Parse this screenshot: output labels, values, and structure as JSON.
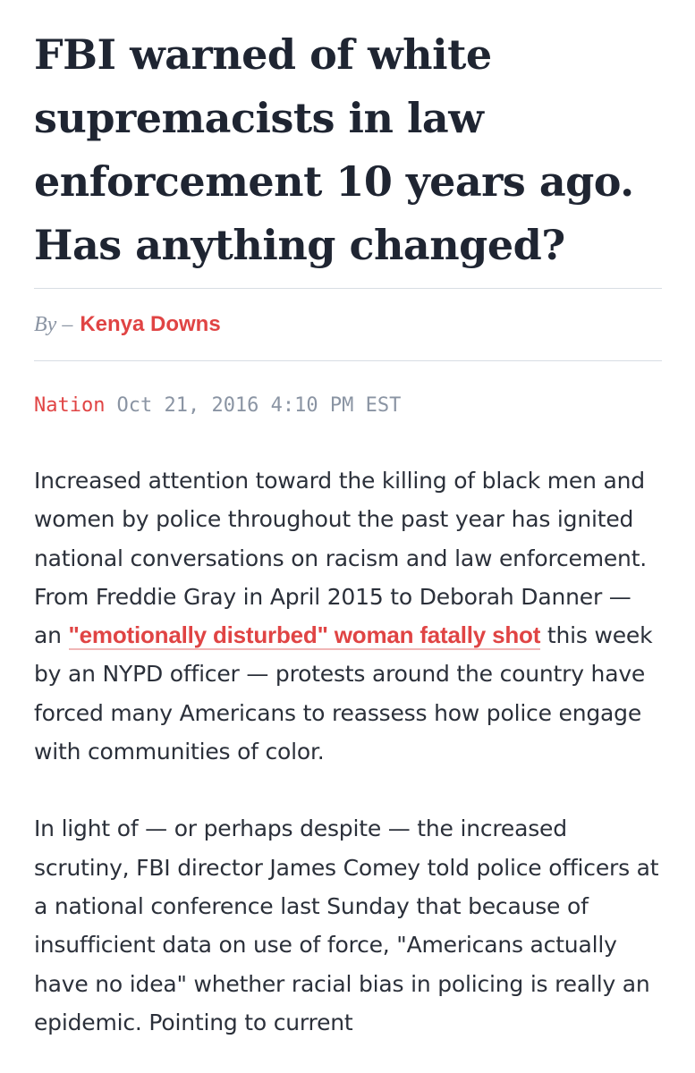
{
  "article": {
    "headline": "FBI warned of white supremacists in law enforcement 10 years ago. Has anything changed?",
    "byline": {
      "prefix": "By –",
      "author": "Kenya Downs"
    },
    "meta": {
      "section": "Nation",
      "timestamp": "Oct 21, 2016 4:10 PM EST"
    },
    "paragraphs": [
      {
        "before_link": "Increased attention toward the killing of black men and women by police throughout the past year has ignited national conversations on racism and law enforcement. From Freddie Gray in April 2015 to Deborah Danner — an ",
        "link_text": "\"emotionally disturbed\" woman fatally shot",
        "after_link": " this week by an NYPD officer — protests around the country have forced many Americans to reassess how police engage with communities of color."
      },
      {
        "text": "In light of — or perhaps despite — the increased scrutiny, FBI director James Comey told police officers at a national conference last Sunday that because of insufficient data on use of force, \"Americans actually have no idea\" whether racial bias in policing is really an epidemic. Pointing to current"
      }
    ]
  },
  "colors": {
    "headline": "#1f2532",
    "accent": "#e04444",
    "muted": "#8a94a3",
    "body": "#2b303a",
    "rule": "#d7dde3"
  }
}
